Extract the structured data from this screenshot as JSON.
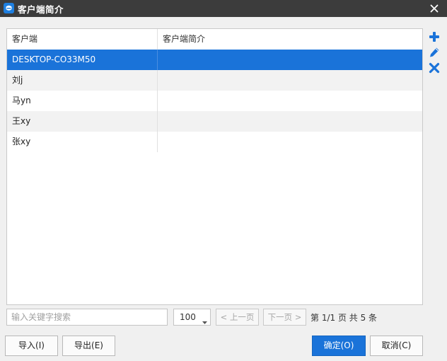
{
  "window": {
    "title": "客户端简介",
    "icon": "app-logo-icon",
    "close_icon": "close-icon",
    "colors": {
      "titlebar": "#3c3c3c",
      "accent": "#1a73d9"
    }
  },
  "table": {
    "columns": [
      "客户端",
      "客户端简介"
    ],
    "rows": [
      {
        "client": "DESKTOP-CO33M50",
        "description": "",
        "selected": true
      },
      {
        "client": "刘j",
        "description": ""
      },
      {
        "client": "马yn",
        "description": ""
      },
      {
        "client": "王xy",
        "description": ""
      },
      {
        "client": "张xy",
        "description": ""
      }
    ]
  },
  "side_tools": [
    {
      "icon": "plus-icon",
      "action": "add"
    },
    {
      "icon": "pencil-icon",
      "action": "edit"
    },
    {
      "icon": "delete-x-icon",
      "action": "delete"
    }
  ],
  "footer": {
    "search_placeholder": "输入关键字搜索",
    "page_size": "100",
    "prev_label": "< 上一页",
    "next_label": "下一页 >",
    "page_info": "第 1/1 页  共 5 条"
  },
  "buttons": {
    "import": "导入(I)",
    "export": "导出(E)",
    "ok": "确定(O)",
    "cancel": "取消(C)"
  }
}
